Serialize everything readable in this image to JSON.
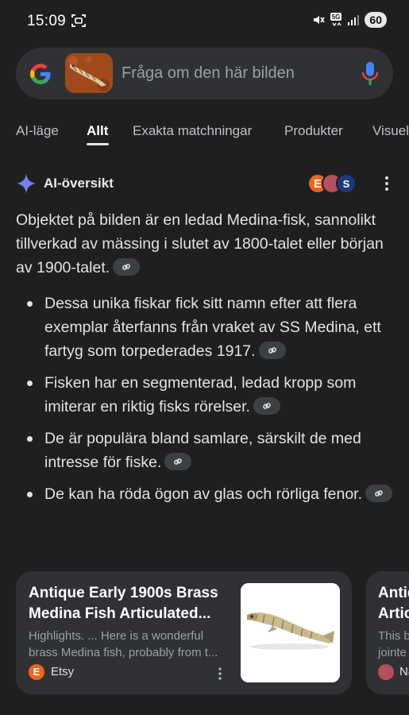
{
  "status_bar": {
    "time": "15:09",
    "battery": "60",
    "network": "5G",
    "icons": [
      "screen-capture-icon",
      "mute-icon",
      "network-5g-icon",
      "signal-icon",
      "battery-icon"
    ]
  },
  "search": {
    "placeholder": "Fråga om den här bilden",
    "icons": [
      "google-logo-icon",
      "mic-icon"
    ]
  },
  "tabs": [
    {
      "label": "AI-läge",
      "active": false
    },
    {
      "label": "Allt",
      "active": true
    },
    {
      "label": "Exakta matchningar",
      "active": false
    },
    {
      "label": "Produkter",
      "active": false
    },
    {
      "label": "Visuel",
      "active": false
    }
  ],
  "ai_overview": {
    "title": "AI-översikt",
    "source_avatars": [
      {
        "letter": "E",
        "color": "#f1641e"
      },
      {
        "letter": "",
        "color": "#b3505c"
      },
      {
        "letter": "S",
        "color": "#1f3a7a"
      }
    ],
    "intro": "Objektet på bilden är en ledad Medina-fisk, sannolikt tillverkad av mässing i slutet av 1800-talet eller början av 1900-talet.",
    "bullets": [
      "Dessa unika fiskar fick sitt namn efter att flera exemplar återfanns från vraket av SS Medina, ett fartyg som torpederades 1917.",
      "Fisken har en segmenterad, ledad kropp som imiterar en riktig fisks rörelser.",
      "De är populära bland samlare, särskilt de med intresse för fiske.",
      "De kan ha röda ögon av glas och rörliga fenor."
    ]
  },
  "cards": [
    {
      "title": "Antique Early 1900s Brass Medina Fish Articulated...",
      "snippet": "Highlights. ... Here is a wonderful brass Medina fish, probably from t...",
      "source": "Etsy",
      "source_letter": "E"
    },
    {
      "title_line1": "Antiq",
      "title_line2": "Artic",
      "snippet_line1": "This b",
      "snippet_line2": "jointe",
      "source": "Na"
    }
  ],
  "colors": {
    "background": "#1f1f1f",
    "surface": "#303134",
    "text": "#e3e3e3",
    "muted": "#9aa0a6",
    "etsy": "#f1641e"
  }
}
